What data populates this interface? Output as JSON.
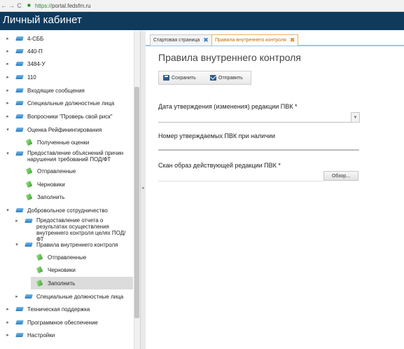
{
  "browser": {
    "url_protocol": "https://",
    "url_host": "portal.fedsfm.ru"
  },
  "header": {
    "title": "Личный кабинет"
  },
  "sidebar": {
    "items": [
      {
        "label": "4-СББ"
      },
      {
        "label": "440-П"
      },
      {
        "label": "3484-У"
      },
      {
        "label": "110"
      },
      {
        "label": "Входящие сообщения"
      },
      {
        "label": "Специальные должностные лица"
      },
      {
        "label": "Вопросники \"Проверь свой риск\""
      },
      {
        "label": "Оценка Рейфинингирования"
      },
      {
        "label": "Полученные оценки"
      },
      {
        "label": "Предоставление объяснений причин нарушения требований ПОД/ФТ"
      },
      {
        "label": "Отправленные"
      },
      {
        "label": "Черновики"
      },
      {
        "label": "Заполнить"
      },
      {
        "label": "Добровольное сотрудничество"
      },
      {
        "label": "Предоставление отчета о результатах осуществления внутреннего контроля целях ПОД/ФТ"
      },
      {
        "label": "Правила внутреннего контроля"
      },
      {
        "label": "Отправленные"
      },
      {
        "label": "Черновики"
      },
      {
        "label": "Заполнить"
      },
      {
        "label": "Специальные должностные лица"
      },
      {
        "label": "Техническая поддержка"
      },
      {
        "label": "Программное обеспечение"
      },
      {
        "label": "Настройки"
      }
    ]
  },
  "tabs": [
    {
      "label": "Стартовая страница"
    },
    {
      "label": "Правила внутреннего контроля"
    }
  ],
  "form": {
    "title": "Правила внутреннего контроля",
    "save_label": "Сохранить",
    "send_label": "Отправить",
    "date_label": "Дата утверждения (изменения) редакции ПВК *",
    "number_label": "Номер утверждаемых ПВК при наличии",
    "scan_label": "Скан образ действующей редакции ПВК *",
    "browse_label": "Обзор..."
  },
  "colors": {
    "header_bg": "#0f3a5c",
    "active_tab": "#c06c00",
    "accent_blue": "#9ac4e4"
  }
}
